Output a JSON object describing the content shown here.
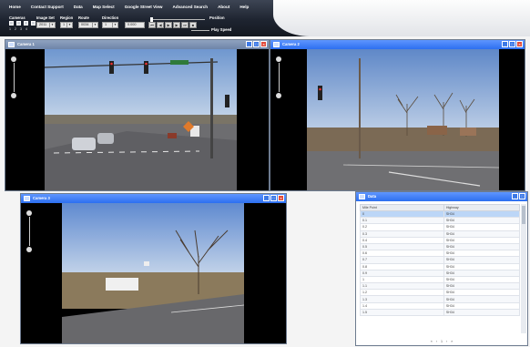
{
  "menu": [
    "Home",
    "Contact Support",
    "Data",
    "Map Select",
    "Google Street View",
    "Advanced Search",
    "About",
    "Help"
  ],
  "toolbar": {
    "cameras_label": "Cameras",
    "camera_numbers": [
      "1",
      "2",
      "3",
      "4"
    ],
    "image_set_label": "Image Set",
    "image_set_value": "2011",
    "region_label": "Region",
    "region_value": "1",
    "route_label": "Route",
    "route_value": "0034",
    "direction_label": "Direction",
    "direction_value": "1",
    "milepoint_value": "0.000",
    "position_label": "Position",
    "play_speed_label": "Play Speed"
  },
  "windows": {
    "camera1_title": "Camera 1",
    "camera2_title": "Camera 2",
    "camera3_title": "Camera 3",
    "data_title": "Data"
  },
  "data_table": {
    "headers": [
      "Mile Point",
      "Highway"
    ],
    "rows": [
      [
        "0",
        "SH34"
      ],
      [
        "0.1",
        "SH34"
      ],
      [
        "0.2",
        "SH34"
      ],
      [
        "0.3",
        "SH34"
      ],
      [
        "0.4",
        "SH34"
      ],
      [
        "0.5",
        "SH34"
      ],
      [
        "0.6",
        "SH34"
      ],
      [
        "0.7",
        "SH34"
      ],
      [
        "0.8",
        "SH34"
      ],
      [
        "0.9",
        "SH34"
      ],
      [
        "1",
        "SH34"
      ],
      [
        "1.1",
        "SH34"
      ],
      [
        "1.2",
        "SH34"
      ],
      [
        "1.3",
        "SH34"
      ],
      [
        "1.4",
        "SH34"
      ],
      [
        "1.5",
        "SH34"
      ]
    ],
    "selected_index": 0
  },
  "pager": {
    "first": "«",
    "prev": "‹",
    "page": "1",
    "next": "›",
    "last": "»"
  },
  "colors": {
    "toolbar_dark": "#1e2430",
    "title_active": "#2d6ff0",
    "title_inactive": "#6e84a8",
    "close_red": "#e04a3a",
    "row_selected": "#bcd6f7"
  },
  "icons": [
    "window-icon",
    "minimize-icon",
    "maximize-icon",
    "close-icon",
    "zoom-slider-icon"
  ]
}
